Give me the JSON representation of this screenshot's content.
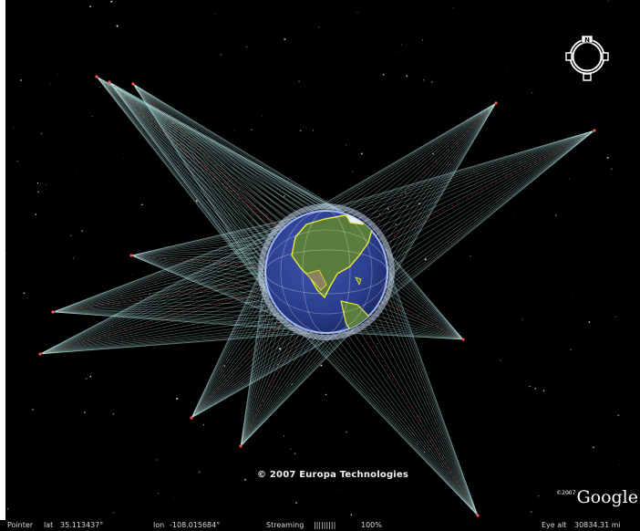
{
  "viewer": {
    "copyright": "© 2007 Europa Technologies",
    "logo_year": "©2007",
    "logo_text": "Google",
    "compass_north": "N"
  },
  "status": {
    "pointer_label": "Pointer",
    "lat_label": "lat",
    "lat_value": "35.113437°",
    "lon_label": "lon",
    "lon_value": "-108.015684°",
    "streaming_label": "Streaming",
    "streaming_bar": "|||||||||",
    "streaming_percent": "100%",
    "eye_alt_label": "Eye alt",
    "eye_alt_value": "30834.31 mi"
  },
  "colors": {
    "space": "#000000",
    "beam": "#b8ece6",
    "orbit": "#d21e1e",
    "globe_ocean": "#2a3d8c",
    "globe_rim": "#9fb4ff",
    "coastline": "#e8e840"
  }
}
